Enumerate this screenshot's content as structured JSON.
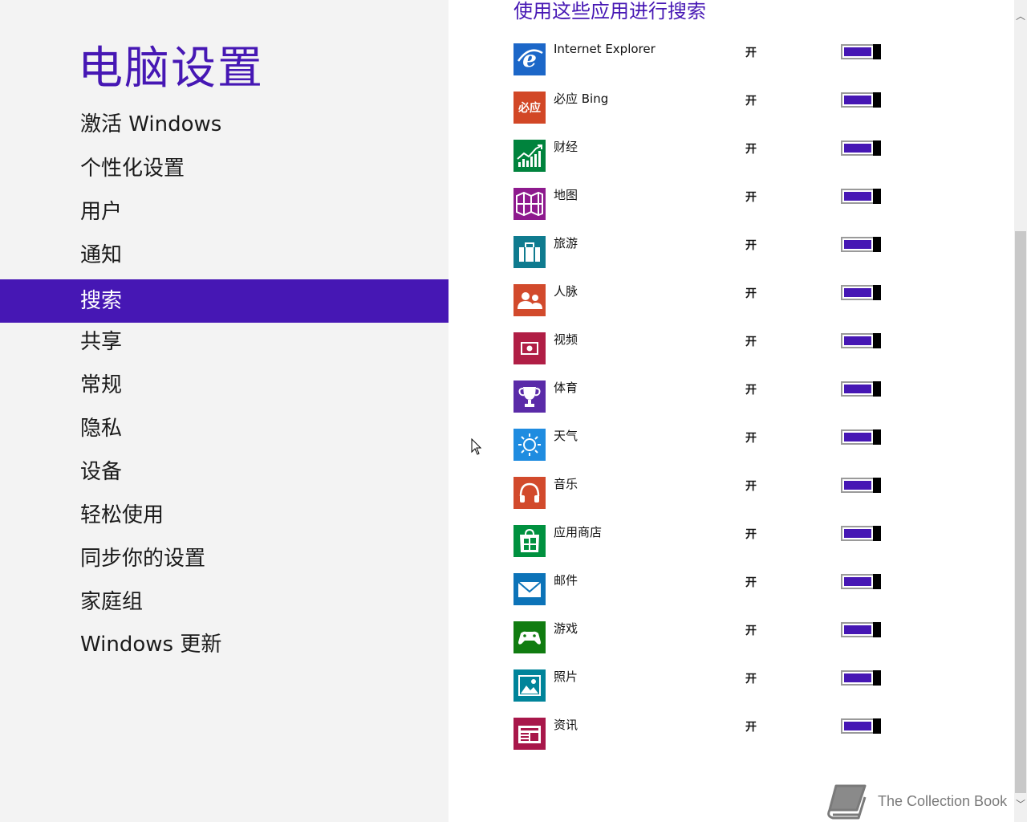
{
  "sidebar": {
    "title": "电脑设置",
    "items": [
      {
        "label": "激活 Windows",
        "selected": false
      },
      {
        "label": "个性化设置",
        "selected": false
      },
      {
        "label": "用户",
        "selected": false
      },
      {
        "label": "通知",
        "selected": false
      },
      {
        "label": "搜索",
        "selected": true
      },
      {
        "label": "共享",
        "selected": false
      },
      {
        "label": "常规",
        "selected": false
      },
      {
        "label": "隐私",
        "selected": false
      },
      {
        "label": "设备",
        "selected": false
      },
      {
        "label": "轻松使用",
        "selected": false
      },
      {
        "label": "同步你的设置",
        "selected": false
      },
      {
        "label": "家庭组",
        "selected": false
      },
      {
        "label": "Windows 更新",
        "selected": false
      }
    ]
  },
  "main": {
    "section_heading": "使用这些应用进行搜索",
    "apps": [
      {
        "name": "Internet Explorer",
        "state": "开",
        "on": true,
        "icon": "ie-icon",
        "color": "#1c67c8"
      },
      {
        "name": "必应 Bing",
        "state": "开",
        "on": true,
        "icon": "bing-icon",
        "color": "#d24726",
        "tile_text": "必应"
      },
      {
        "name": "财经",
        "state": "开",
        "on": true,
        "icon": "finance-icon",
        "color": "#00833d"
      },
      {
        "name": "地图",
        "state": "开",
        "on": true,
        "icon": "maps-icon",
        "color": "#8e1a8e"
      },
      {
        "name": "旅游",
        "state": "开",
        "on": true,
        "icon": "travel-icon",
        "color": "#0f7b8f"
      },
      {
        "name": "人脉",
        "state": "开",
        "on": true,
        "icon": "people-icon",
        "color": "#d24a2c"
      },
      {
        "name": "视频",
        "state": "开",
        "on": true,
        "icon": "video-icon",
        "color": "#b01e45"
      },
      {
        "name": "体育",
        "state": "开",
        "on": true,
        "icon": "sports-icon",
        "color": "#5a2ba8"
      },
      {
        "name": "天气",
        "state": "开",
        "on": true,
        "icon": "weather-icon",
        "color": "#1f8ce0"
      },
      {
        "name": "音乐",
        "state": "开",
        "on": true,
        "icon": "music-icon",
        "color": "#d24a2c"
      },
      {
        "name": "应用商店",
        "state": "开",
        "on": true,
        "icon": "store-icon",
        "color": "#00913f"
      },
      {
        "name": "邮件",
        "state": "开",
        "on": true,
        "icon": "mail-icon",
        "color": "#0c73b8"
      },
      {
        "name": "游戏",
        "state": "开",
        "on": true,
        "icon": "games-icon",
        "color": "#107c10"
      },
      {
        "name": "照片",
        "state": "开",
        "on": true,
        "icon": "photos-icon",
        "color": "#00849a"
      },
      {
        "name": "资讯",
        "state": "开",
        "on": true,
        "icon": "news-icon",
        "color": "#a8174a"
      }
    ]
  },
  "watermark": {
    "text": "The Collection Book",
    "icon": "book-icon"
  },
  "colors": {
    "accent": "#4617b4",
    "sidebar_bg": "#f3f3f3"
  }
}
